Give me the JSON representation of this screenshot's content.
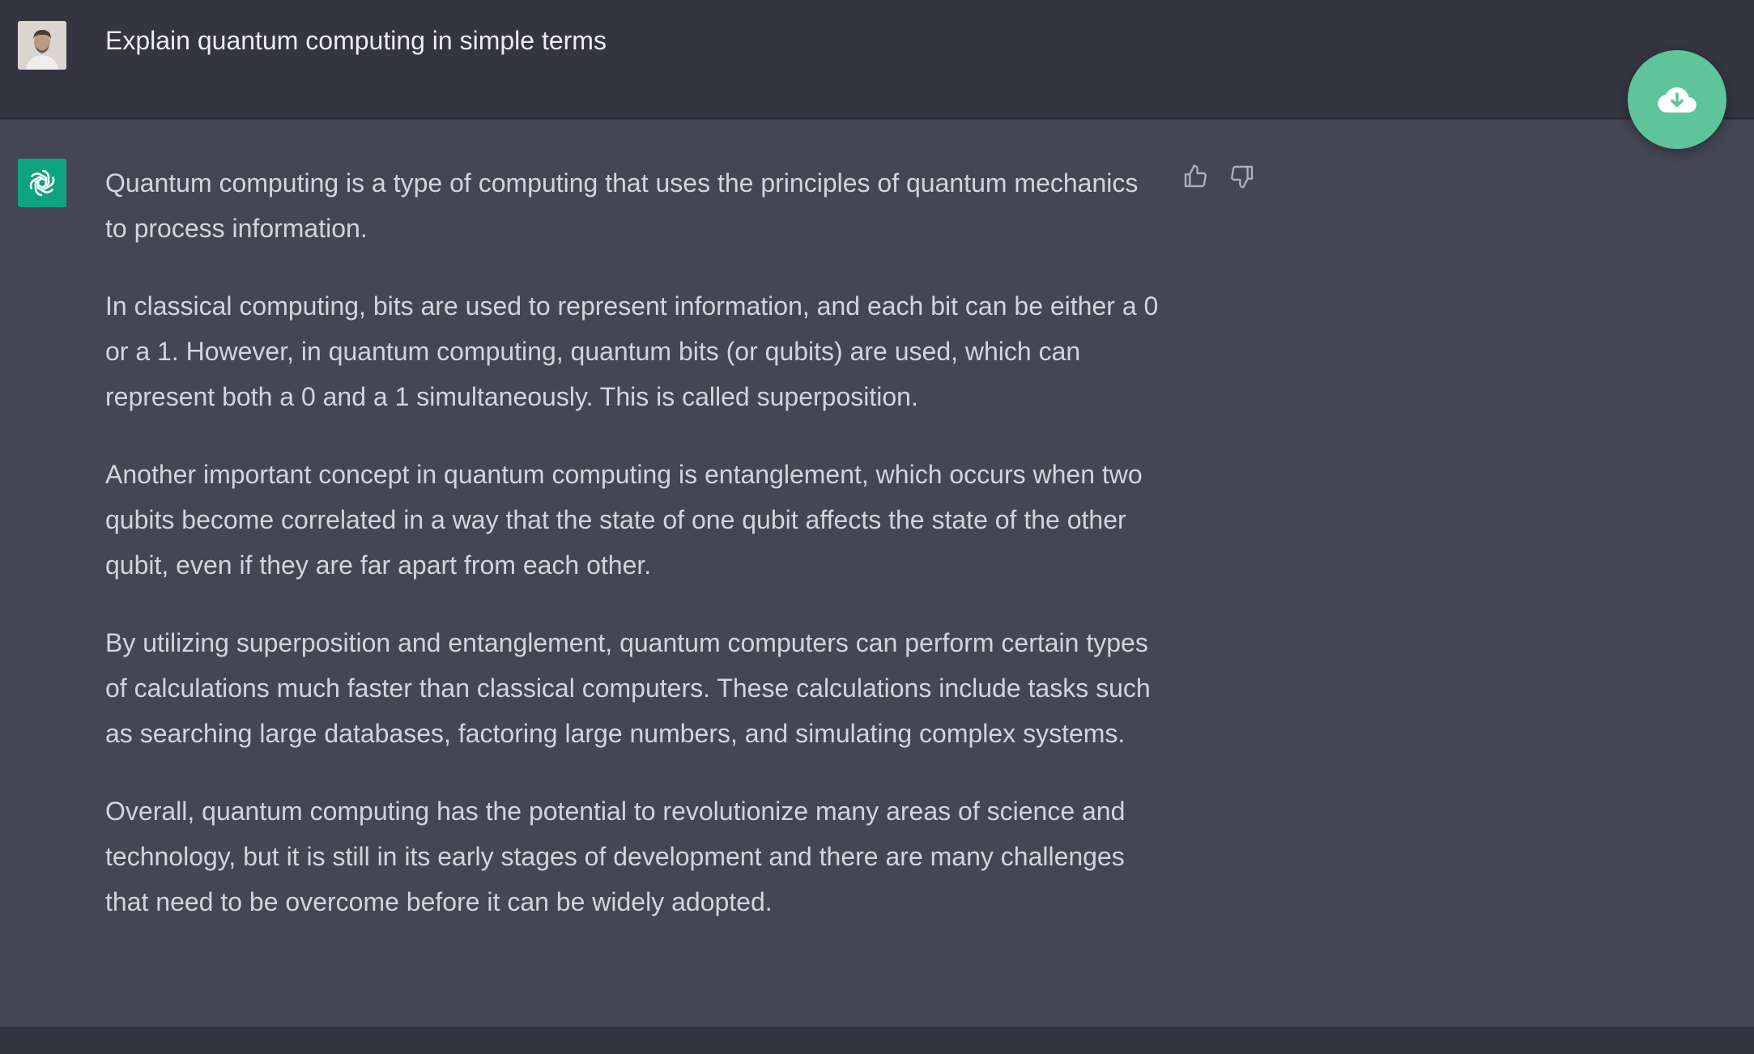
{
  "prompt": {
    "text": "Explain quantum computing in simple terms",
    "avatar_icon": "user-avatar"
  },
  "response": {
    "avatar_icon": "openai-logo-icon",
    "paragraphs": [
      "Quantum computing is a type of computing that uses the principles of quantum mechanics to process information.",
      "In classical computing, bits are used to represent information, and each bit can be either a 0 or a 1. However, in quantum computing, quantum bits (or qubits) are used, which can represent both a 0 and a 1 simultaneously. This is called superposition.",
      "Another important concept in quantum computing is entanglement, which occurs when two qubits become correlated in a way that the state of one qubit affects the state of the other qubit, even if they are far apart from each other.",
      "By utilizing superposition and entanglement, quantum computers can perform certain types of calculations much faster than classical computers. These calculations include tasks such as searching large databases, factoring large numbers, and simulating complex systems.",
      "Overall, quantum computing has the potential to revolutionize many areas of science and technology, but it is still in its early stages of development and there are many challenges that need to be overcome before it can be widely adopted."
    ],
    "feedback_icons": [
      "thumbs-up-icon",
      "thumbs-down-icon"
    ]
  },
  "fab": {
    "icon": "cloud-download-icon"
  },
  "colors": {
    "user_row_bg": "#343541",
    "assistant_row_bg": "#444654",
    "brand_green": "#10a37f",
    "fab_green": "#5ec49a",
    "text": "#d1d5db"
  }
}
